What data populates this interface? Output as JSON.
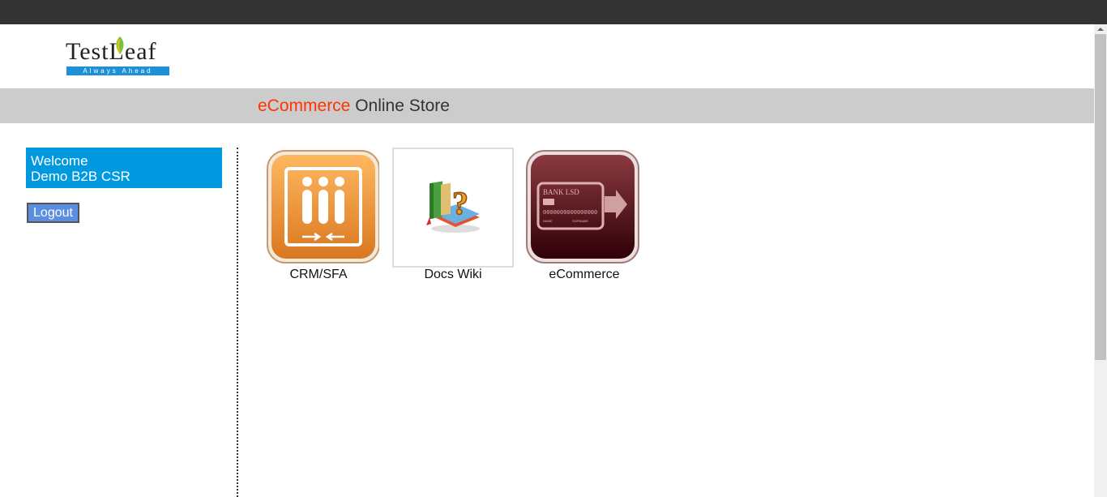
{
  "brand": {
    "logo_text": "TestLeaf",
    "logo_tagline": "Always Ahead"
  },
  "page": {
    "title_accent": "eCommerce",
    "title_rest": " Online Store"
  },
  "sidebar": {
    "welcome_line1": "Welcome",
    "welcome_line2": "Demo B2B CSR",
    "logout_label": "Logout"
  },
  "apps": [
    {
      "label": "CRM/SFA",
      "icon": "crm-sfa-icon"
    },
    {
      "label": "Docs Wiki",
      "icon": "docs-wiki-icon"
    },
    {
      "label": "eCommerce",
      "icon": "ecommerce-icon"
    }
  ],
  "icon_text": {
    "bank": "BANK LSD",
    "card_number": "0000000000000000",
    "name": "NAME",
    "surname": "SURNAME"
  },
  "colors": {
    "accent": "#ff3300",
    "welcome_bg": "#0099e0",
    "logout_bg": "#5b8de0",
    "title_band": "#cccccc",
    "top_bar": "#333333"
  }
}
